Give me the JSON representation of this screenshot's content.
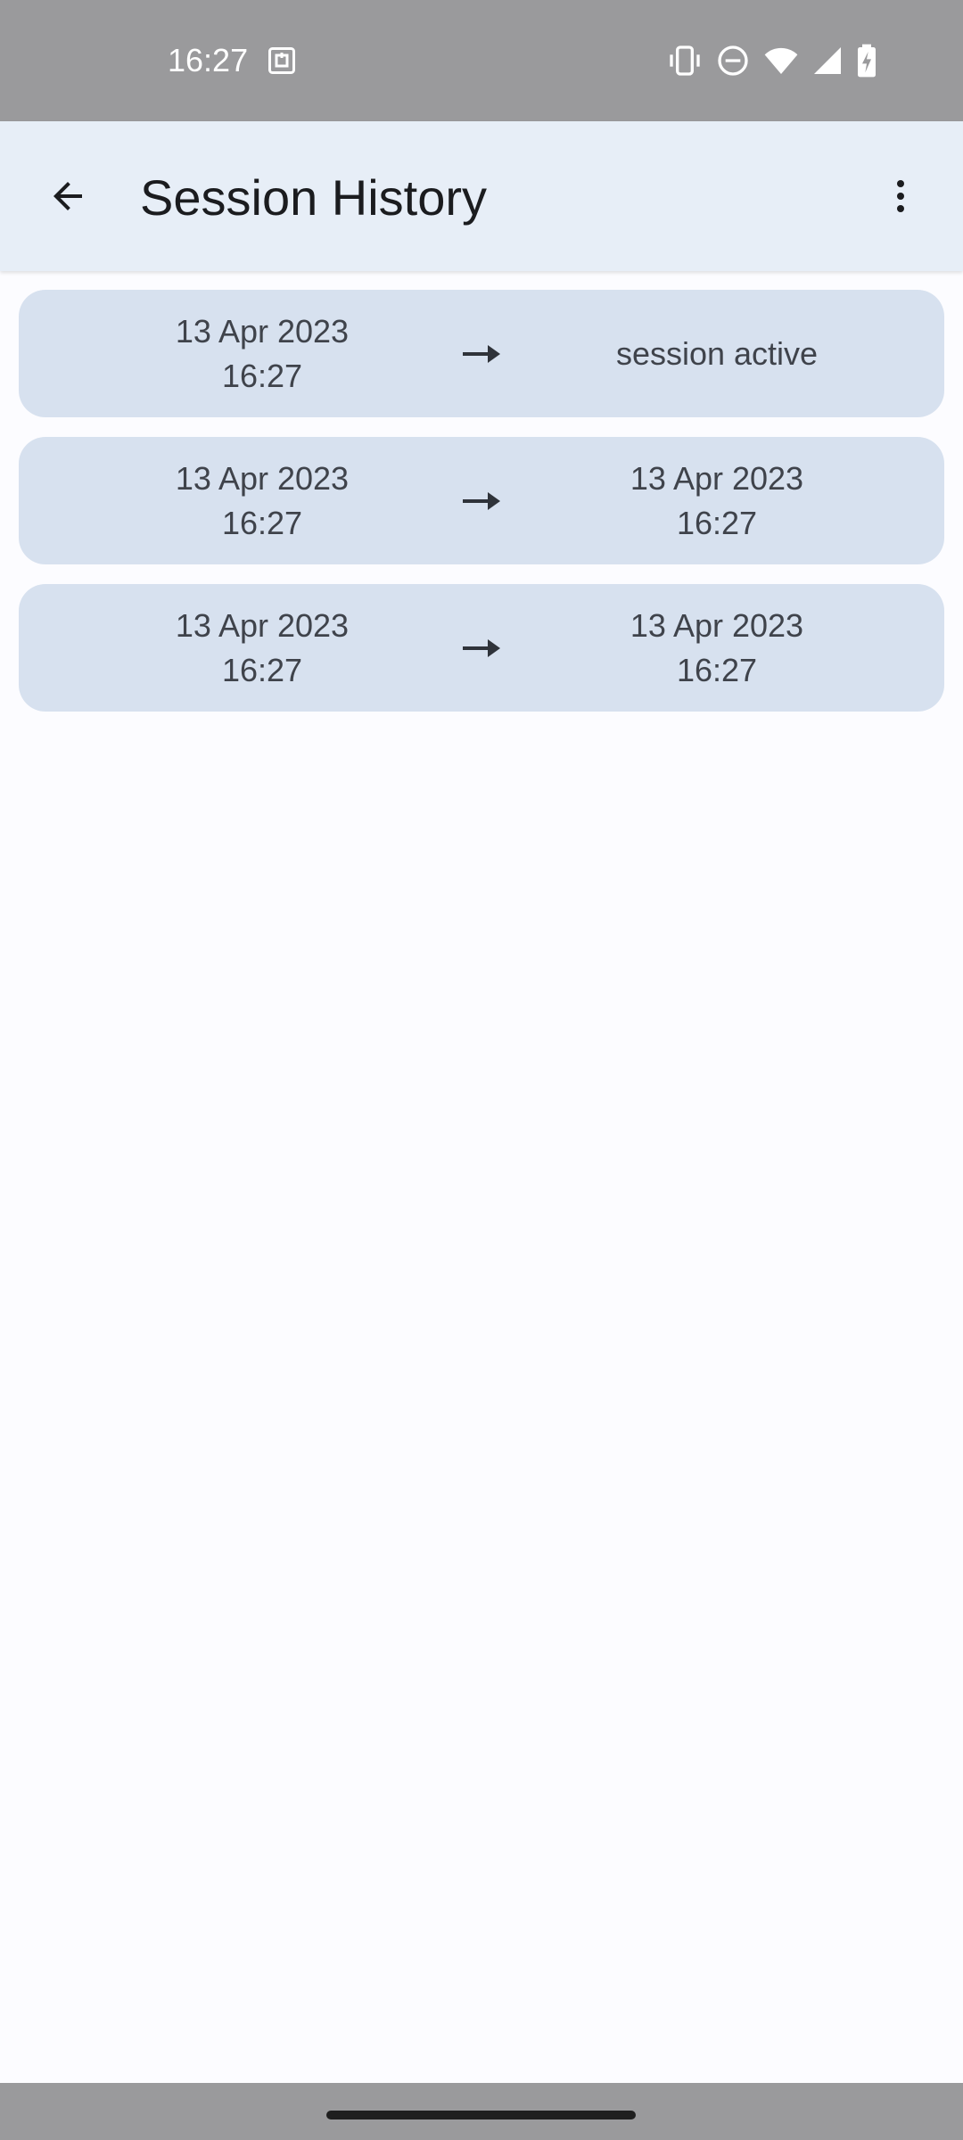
{
  "status_bar": {
    "time": "16:27",
    "icons": [
      "nfc-icon",
      "vibrate-icon",
      "do-not-disturb-icon",
      "wifi-icon",
      "cellular-signal-icon",
      "battery-charging-icon"
    ]
  },
  "app_bar": {
    "title": "Session History",
    "icons": [
      "back-arrow-icon",
      "more-vert-icon"
    ]
  },
  "sessions": [
    {
      "start_date": "13 Apr 2023",
      "start_time": "16:27",
      "end_date": "",
      "end_time": "",
      "end_status": "session active"
    },
    {
      "start_date": "13 Apr 2023",
      "start_time": "16:27",
      "end_date": "13 Apr 2023",
      "end_time": "16:27"
    },
    {
      "start_date": "13 Apr 2023",
      "start_time": "16:27",
      "end_date": "13 Apr 2023",
      "end_time": "16:27"
    }
  ],
  "colors": {
    "status_bar": "#9a9a9c",
    "app_bar": "#e7eef7",
    "card": "#d7e1ef",
    "background": "#fcfcff",
    "text": "#3f434b"
  }
}
